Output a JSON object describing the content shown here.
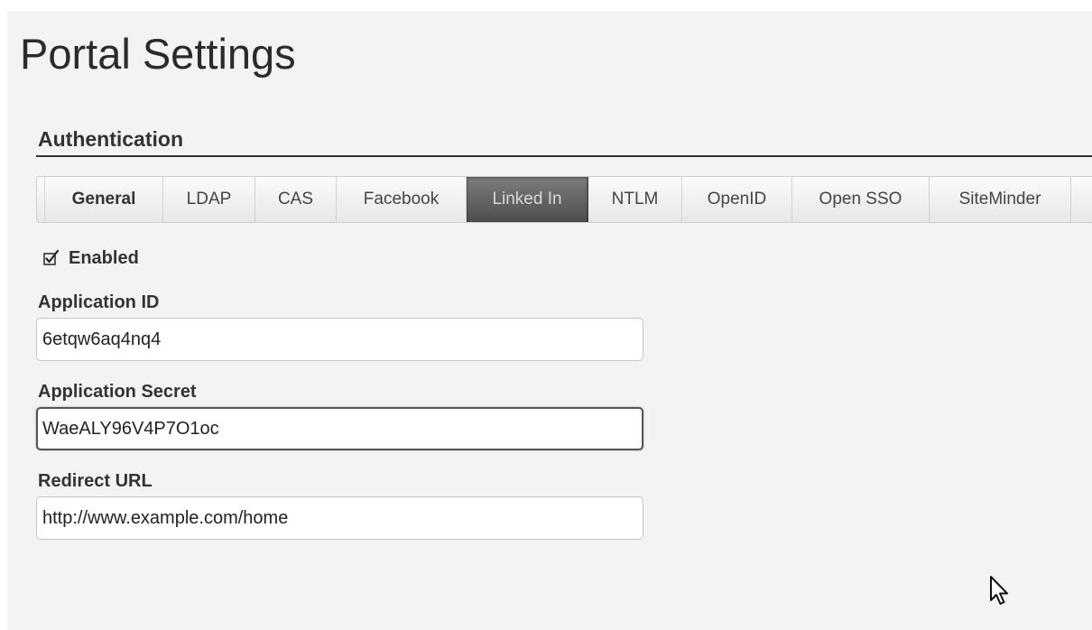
{
  "page": {
    "title": "Portal Settings"
  },
  "section": {
    "title": "Authentication"
  },
  "tabs": [
    {
      "label": "General",
      "active": false,
      "bold": true
    },
    {
      "label": "LDAP",
      "active": false,
      "bold": false
    },
    {
      "label": "CAS",
      "active": false,
      "bold": false
    },
    {
      "label": "Facebook",
      "active": false,
      "bold": false
    },
    {
      "label": "Linked In",
      "active": true,
      "bold": false
    },
    {
      "label": "NTLM",
      "active": false,
      "bold": false
    },
    {
      "label": "OpenID",
      "active": false,
      "bold": false
    },
    {
      "label": "Open SSO",
      "active": false,
      "bold": false
    },
    {
      "label": "SiteMinder",
      "active": false,
      "bold": false
    }
  ],
  "enabled": {
    "label": "Enabled",
    "checked": true
  },
  "fields": {
    "application_id": {
      "label": "Application ID",
      "value": "6etqw6aq4nq4"
    },
    "application_secret": {
      "label": "Application Secret",
      "value": "WaeALY96V4P7O1oc"
    },
    "redirect_url": {
      "label": "Redirect URL",
      "value": "http://www.example.com/home"
    }
  },
  "icons": {
    "checkbox": "checkmark-icon",
    "cursor": "mouse-pointer-icon"
  },
  "colors": {
    "active_tab_bg": "#5e5e5e",
    "active_tab_text": "#d8d8d8",
    "page_bg": "#f3f3f3"
  }
}
